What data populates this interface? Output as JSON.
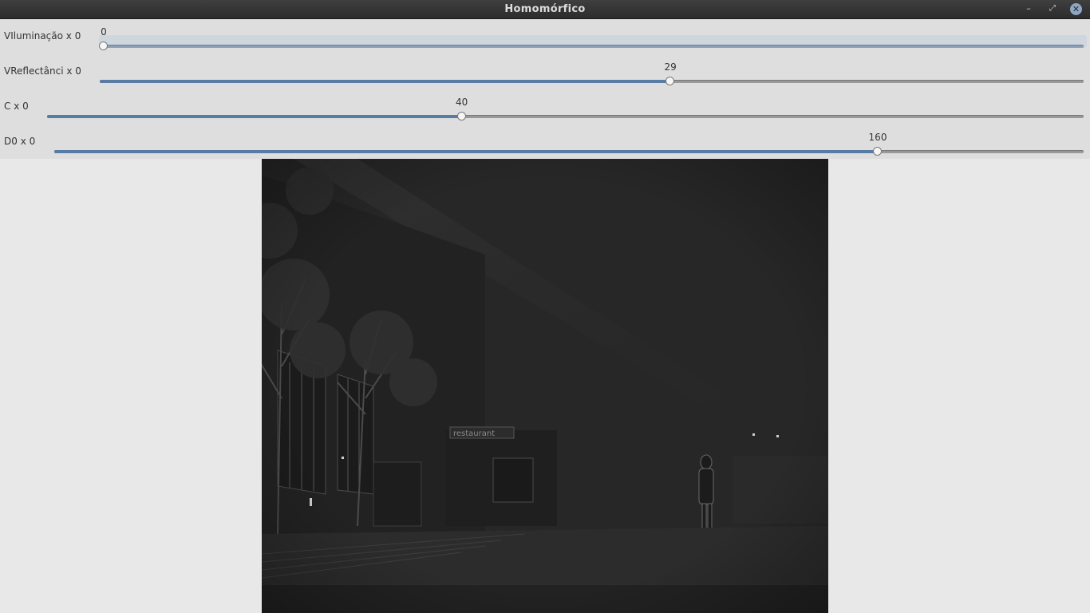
{
  "window": {
    "title": "Homomórfico",
    "buttons": {
      "minimize": "–",
      "maximize": "⤢",
      "close": "✕"
    }
  },
  "sliders": [
    {
      "label": "VIluminação x 0",
      "value": "0",
      "max": 100
    },
    {
      "label": "VReflectânci x 0",
      "value": "29",
      "max": 50
    },
    {
      "label": "C x 0",
      "value": "40",
      "max": 100
    },
    {
      "label": "D0 x 0",
      "value": "160",
      "max": 200
    }
  ],
  "image": {
    "scene_elements": [
      "sign-text"
    ],
    "sign_text": "restaurant"
  },
  "colors": {
    "accent": "#587ca3",
    "titlebar": "#2f2f2f",
    "image_bg": "#262626"
  }
}
